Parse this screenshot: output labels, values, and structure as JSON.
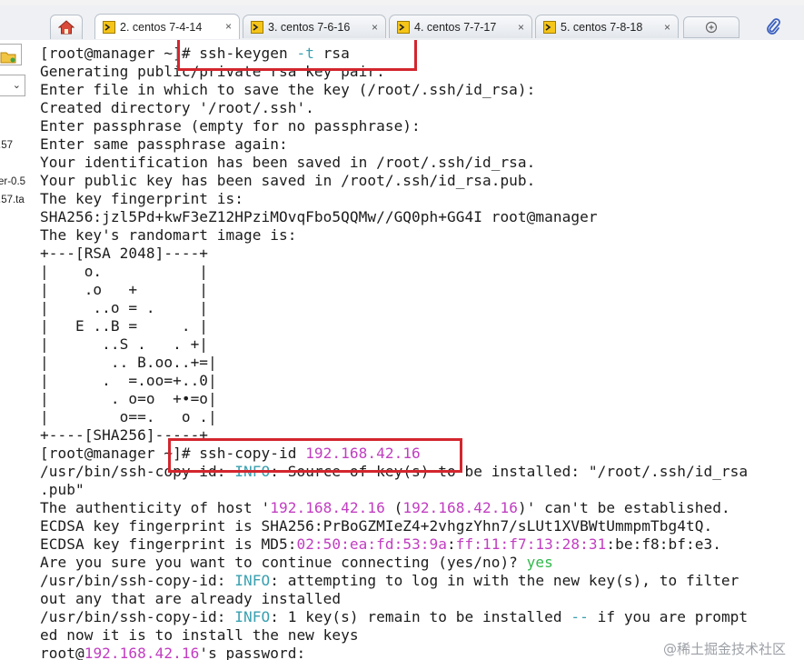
{
  "tabs": [
    {
      "label": "2. centos 7-4-14",
      "active": true
    },
    {
      "label": "3. centos 7-6-16",
      "active": false
    },
    {
      "label": "4. centos 7-7-17",
      "active": false
    },
    {
      "label": "5. centos 7-8-18",
      "active": false
    }
  ],
  "tab_close_glyph": "×",
  "icons": {
    "home": "home-icon",
    "tab": "terminal-tab-icon",
    "new_tab": "new-tab-icon",
    "attach": "paperclip-icon",
    "folder": "folder-icon",
    "dropdown": "chevron-down-icon"
  },
  "sidebar": {
    "texts": [
      ".57",
      "er-0.5",
      ".57.ta"
    ]
  },
  "terminal": {
    "lines": [
      [
        {
          "t": "[root@manager ~]# ssh-keygen "
        },
        {
          "t": "-t",
          "c": "opt"
        },
        {
          "t": " rsa"
        }
      ],
      [
        {
          "t": "Generating public/private rsa key pair."
        }
      ],
      [
        {
          "t": "Enter file in which to save the key (/root/.ssh/id_rsa):"
        }
      ],
      [
        {
          "t": "Created directory '/root/.ssh'."
        }
      ],
      [
        {
          "t": "Enter passphrase (empty for no passphrase):"
        }
      ],
      [
        {
          "t": "Enter same passphrase again:"
        }
      ],
      [
        {
          "t": "Your identification has been saved in /root/.ssh/id_rsa."
        }
      ],
      [
        {
          "t": "Your public key has been saved in /root/.ssh/id_rsa.pub."
        }
      ],
      [
        {
          "t": "The key fingerprint is:"
        }
      ],
      [
        {
          "t": "SHA256:jzl5Pd+kwF3eZ12HPziMOvqFbo5QQMw//GQ0ph+GG4I root@manager"
        }
      ],
      [
        {
          "t": "The key's randomart image is:"
        }
      ],
      [
        {
          "t": "+---[RSA 2048]----+"
        }
      ],
      [
        {
          "t": "|    o.           |"
        }
      ],
      [
        {
          "t": "|    .o   +       |"
        }
      ],
      [
        {
          "t": "|     ..o = .     |"
        }
      ],
      [
        {
          "t": "|   E ..B =     . |"
        }
      ],
      [
        {
          "t": "|      ..S .   . +|"
        }
      ],
      [
        {
          "t": "|       .. B.oo..+=|"
        }
      ],
      [
        {
          "t": "|      .  =.oo=+..0|"
        }
      ],
      [
        {
          "t": "|       . o=o  +•=o|"
        }
      ],
      [
        {
          "t": "|        o==.   o .|"
        }
      ],
      [
        {
          "t": "+----[SHA256]-----+"
        }
      ],
      [
        {
          "t": "[root@manager ~]# ssh-copy-id "
        },
        {
          "t": "192.168.42.16",
          "c": "ip"
        }
      ],
      [
        {
          "t": "/usr/bin/ssh-copy-id: "
        },
        {
          "t": "INFO",
          "c": "info"
        },
        {
          "t": ": Source of key(s) to be installed: \"/root/.ssh/id_rsa"
        }
      ],
      [
        {
          "t": ".pub\""
        }
      ],
      [
        {
          "t": "The authenticity of host '"
        },
        {
          "t": "192.168.42.16",
          "c": "ip"
        },
        {
          "t": " ("
        },
        {
          "t": "192.168.42.16",
          "c": "ip"
        },
        {
          "t": ")' can't be established."
        }
      ],
      [
        {
          "t": "ECDSA key fingerprint is SHA256:PrBoGZMIeZ4+2vhgzYhn7/sLUt1XVBWtUmmpmTbg4tQ."
        }
      ],
      [
        {
          "t": "ECDSA key fingerprint is MD5:"
        },
        {
          "t": "02:50:ea:fd:53:9a",
          "c": "ip"
        },
        {
          "t": ":"
        },
        {
          "t": "ff:11:f7:13:28:31",
          "c": "ip"
        },
        {
          "t": ":be:f8:bf:e3."
        }
      ],
      [
        {
          "t": "Are you sure you want to continue connecting (yes/no)? "
        },
        {
          "t": "yes",
          "c": "yes"
        }
      ],
      [
        {
          "t": "/usr/bin/ssh-copy-id: "
        },
        {
          "t": "INFO",
          "c": "info"
        },
        {
          "t": ": attempting to log in with the new key(s), to filter"
        }
      ],
      [
        {
          "t": "out any that are already installed"
        }
      ],
      [
        {
          "t": "/usr/bin/ssh-copy-id: "
        },
        {
          "t": "INFO",
          "c": "info"
        },
        {
          "t": ": 1 key(s) remain to be installed "
        },
        {
          "t": "--",
          "c": "dash"
        },
        {
          "t": " if you are prompt"
        }
      ],
      [
        {
          "t": "ed now it is to install the new keys"
        }
      ],
      [
        {
          "t": "root@"
        },
        {
          "t": "192.168.42.16",
          "c": "ip"
        },
        {
          "t": "'s password:"
        }
      ]
    ]
  },
  "watermark": "@稀土掘金技术社区",
  "colors": {
    "highlight_box": "#d3262e",
    "option": "#3aa0b0",
    "ip": "#c13ec1",
    "info": "#3aa0b0",
    "yes": "#2fb84a"
  }
}
